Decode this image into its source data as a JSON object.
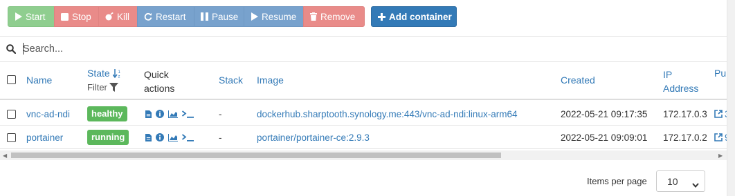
{
  "toolbar": {
    "start": "Start",
    "stop": "Stop",
    "kill": "Kill",
    "restart": "Restart",
    "pause": "Pause",
    "resume": "Resume",
    "remove": "Remove",
    "add_container": "Add container"
  },
  "search": {
    "placeholder": "Search..."
  },
  "table": {
    "headers": {
      "name": "Name",
      "state": "State",
      "state_filter": "Filter",
      "quick_actions_line1": "Quick",
      "quick_actions_line2": "actions",
      "stack": "Stack",
      "image": "Image",
      "created": "Created",
      "ip_line1": "IP",
      "ip_line2": "Address",
      "ports": "Pu"
    },
    "rows": [
      {
        "name": "vnc-ad-ndi",
        "state": "healthy",
        "stack": "-",
        "image": "dockerhub.sharptooth.synology.me:443/vnc-ad-ndi:linux-arm64",
        "created": "2022-05-21 09:17:35",
        "ip": "172.17.0.3",
        "ports": "3"
      },
      {
        "name": "portainer",
        "state": "running",
        "stack": "-",
        "image": "portainer/portainer-ce:2.9.3",
        "created": "2022-05-21 09:09:01",
        "ip": "172.17.0.2",
        "ports": "9"
      }
    ]
  },
  "pagination": {
    "items_per_page_label": "Items per page",
    "items_per_page_value": "10"
  },
  "colors": {
    "link": "#337ab7",
    "success_badge": "#5cb85c",
    "btn_success": "#8fce8f",
    "btn_danger": "#e98b89",
    "btn_primary": "#78a2cd",
    "btn_add": "#337ab7"
  },
  "icons": [
    "play-icon",
    "stop-icon",
    "bomb-icon",
    "refresh-icon",
    "pause-icon",
    "play-icon",
    "trash-icon",
    "plus-icon",
    "search-icon",
    "sort-icon",
    "filter-icon",
    "logs-icon",
    "info-icon",
    "stats-icon",
    "console-icon",
    "external-link-icon",
    "chevron-down-icon"
  ]
}
